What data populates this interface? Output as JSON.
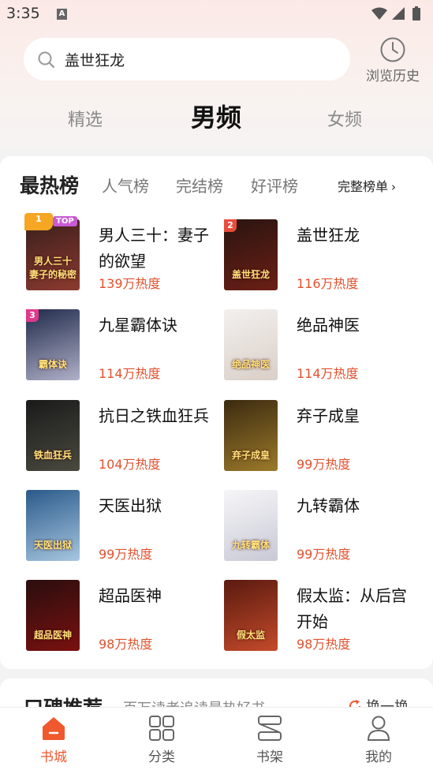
{
  "status_bar": {
    "time": "3:35",
    "notification_letter": "A"
  },
  "search": {
    "placeholder": "盖世狂龙"
  },
  "history": {
    "label": "浏览历史"
  },
  "channels": {
    "featured": "精选",
    "male": "男频",
    "female": "女频"
  },
  "ranking": {
    "title": "最热榜",
    "tabs": [
      "人气榜",
      "完结榜",
      "好评榜"
    ],
    "full_list": "完整榜单",
    "rank1_badge": "TOP",
    "items": [
      {
        "rank": "1",
        "name": "男人三十：妻子的欲望",
        "heat": "139万热度",
        "cover_text": "男人三十 妻子的秘密",
        "cover_colors": [
          "#3a1f1c",
          "#8c3a2f"
        ]
      },
      {
        "rank": "2",
        "name": "盖世狂龙",
        "heat": "116万热度",
        "cover_text": "盖世狂龙",
        "cover_colors": [
          "#2a1410",
          "#6b1f15"
        ]
      },
      {
        "rank": "3",
        "name": "九星霸体诀",
        "heat": "114万热度",
        "cover_text": "霸体诀",
        "cover_colors": [
          "#1f2a4a",
          "#b0b0c8"
        ]
      },
      {
        "rank": "",
        "name": "绝品神医",
        "heat": "114万热度",
        "cover_text": "绝品神医",
        "cover_colors": [
          "#f3f0ee",
          "#d9cfc8"
        ]
      },
      {
        "rank": "",
        "name": "抗日之铁血狂兵",
        "heat": "104万热度",
        "cover_text": "铁血狂兵",
        "cover_colors": [
          "#1a1a1a",
          "#4a4a40"
        ]
      },
      {
        "rank": "",
        "name": "弃子成皇",
        "heat": "99万热度",
        "cover_text": "弃子成皇",
        "cover_colors": [
          "#3b2a10",
          "#9b7a2a"
        ]
      },
      {
        "rank": "",
        "name": "天医出狱",
        "heat": "99万热度",
        "cover_text": "天医出狱",
        "cover_colors": [
          "#2a5a8a",
          "#a7c6e0"
        ]
      },
      {
        "rank": "",
        "name": "九转霸体",
        "heat": "99万热度",
        "cover_text": "九转霸体",
        "cover_colors": [
          "#f6f6f8",
          "#c9c9d6"
        ]
      },
      {
        "rank": "",
        "name": "超品医神",
        "heat": "98万热度",
        "cover_text": "超品医神",
        "cover_colors": [
          "#2a0e0e",
          "#7a1010"
        ]
      },
      {
        "rank": "",
        "name": "假太监：从后宫开始",
        "heat": "98万热度",
        "cover_text": "假太监",
        "cover_colors": [
          "#5a1a10",
          "#c44a2a"
        ]
      }
    ]
  },
  "recommend": {
    "title": "口碑推荐",
    "subtitle": "百万读者追读最热好书",
    "refresh": "换一换"
  },
  "bottom_nav": {
    "bookstore": "书城",
    "category": "分类",
    "shelf": "书架",
    "mine": "我的"
  },
  "colors": {
    "accent": "#f0582e",
    "heat": "#e2512d"
  }
}
